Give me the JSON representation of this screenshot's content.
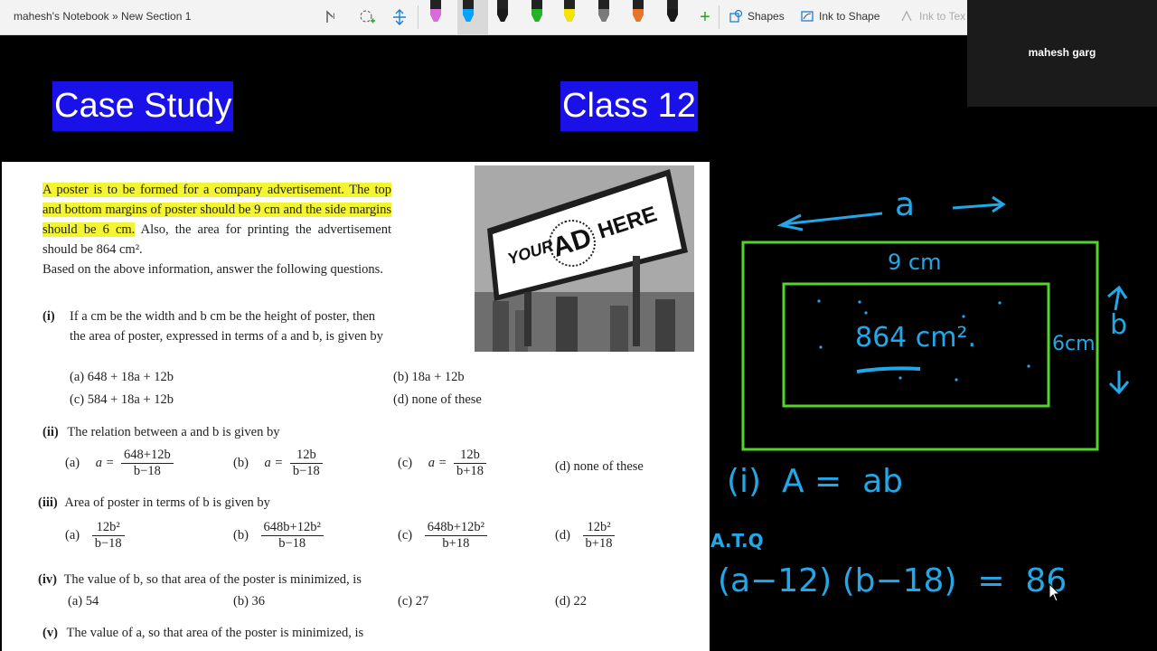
{
  "toolbar": {
    "breadcrumb": "mahesh's Notebook » New Section 1",
    "shapes_label": "Shapes",
    "ink_to_shape_label": "Ink to Shape",
    "ink_to_text_label": "Ink to Tex",
    "pen_colors": [
      "#d86bd8",
      "#00a3ff",
      "#1a1a1a",
      "#24b324",
      "#f5e400",
      "#7a7a7a",
      "#e8742a",
      "#1a1a1a",
      "#1a1a1a"
    ]
  },
  "user": {
    "name": "mahesh garg"
  },
  "titles": {
    "left": "Case Study",
    "right": "Class 12"
  },
  "doc": {
    "para_hl1": "A poster is to be formed for a company advertisement. The top and bottom margins of poster should be 9 cm and the side margins should be 6 cm.",
    "para_rest": " Also, the area for printing the advertisement should be 864 cm².",
    "para2": "Based on the above information, answer the following questions.",
    "billboard": {
      "your": "YOUR",
      "ad": "AD",
      "here": "HERE"
    },
    "q1": {
      "num": "(i)",
      "text": "If a cm be the width and b cm be the height of poster, then the area of poster, expressed in terms of a and b, is given by",
      "a": "(a)  648 + 18a + 12b",
      "b": "(b)  18a + 12b",
      "c": "(c)  584 + 18a + 12b",
      "d": "(d)  none of these"
    },
    "q2": {
      "num": "(ii)",
      "text": "The relation between a and b is given by",
      "a_label": "(a)",
      "a_lhs": "a =",
      "a_num": "648+12b",
      "a_den": "b−18",
      "b_label": "(b)",
      "b_lhs": "a =",
      "b_num": "12b",
      "b_den": "b−18",
      "c_label": "(c)",
      "c_lhs": "a =",
      "c_num": "12b",
      "c_den": "b+18",
      "d": "(d)  none of these"
    },
    "q3": {
      "num": "(iii)",
      "text": "Area of poster in terms of b is given by",
      "a_label": "(a)",
      "a_num": "12b²",
      "a_den": "b−18",
      "b_label": "(b)",
      "b_num": "648b+12b²",
      "b_den": "b−18",
      "c_label": "(c)",
      "c_num": "648b+12b²",
      "c_den": "b+18",
      "d_label": "(d)",
      "d_num": "12b²",
      "d_den": "b+18"
    },
    "q4": {
      "num": "(iv)",
      "text": "The value of b, so that area of the poster is minimized, is",
      "a": "(a)  54",
      "b": "(b)  36",
      "c": "(c)  27",
      "d": "(d)  22"
    },
    "q5": {
      "num": "(v)",
      "text": "The value of a, so that area of the poster is minimized, is"
    }
  },
  "ink": {
    "a_label": "a",
    "top_margin": "9 cm",
    "area": "864 cm².",
    "side_margin": "6cm",
    "b_label": "b",
    "line1": "(i)  A =  ab",
    "ata": "A.T.Q",
    "line2": "(a−12) (b−18)  =  86"
  }
}
